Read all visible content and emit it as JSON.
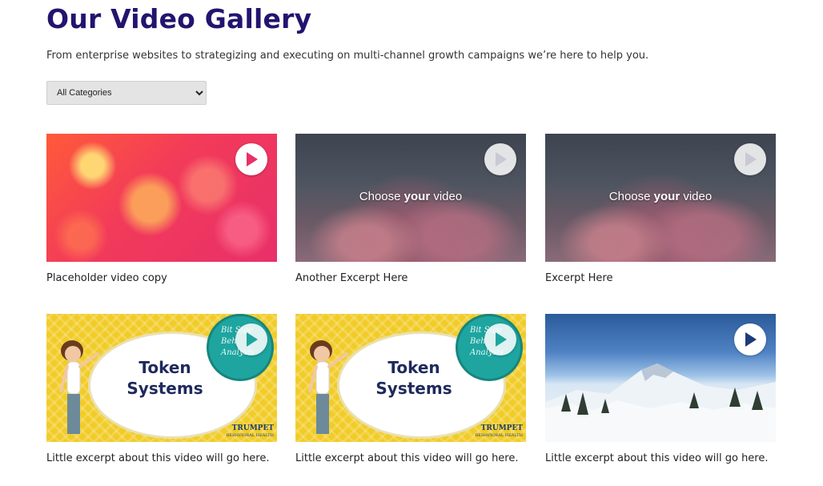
{
  "header": {
    "title": "Our Video Gallery",
    "subtitle": "From enterprise websites to strategizing and executing on multi-channel growth campaigns we’re here to help you."
  },
  "filter": {
    "selected": "All Categories",
    "options": [
      "All Categories"
    ]
  },
  "videos": [
    {
      "caption": "Placeholder video copy",
      "thumbnail": "bokeh"
    },
    {
      "caption": "Another Excerpt Here",
      "thumbnail": "clouds",
      "overlay_pre": "Choose ",
      "overlay_bold": "your",
      "overlay_post": " video"
    },
    {
      "caption": "Excerpt Here",
      "thumbnail": "clouds",
      "overlay_pre": "Choose ",
      "overlay_bold": "your",
      "overlay_post": " video"
    },
    {
      "caption": "Little excerpt about this video will go here.",
      "thumbnail": "token",
      "title_line1": "Token",
      "title_line2": "Systems",
      "badge_line1": "Bit",
      "badge_line2": "Sige",
      "badge_line3": "Beh",
      "badge_line4": "Analysis",
      "logo": "TRUMPET",
      "logo_sub": "BEHAVIORAL HEALTH"
    },
    {
      "caption": "Little excerpt about this video will go here.",
      "thumbnail": "token",
      "title_line1": "Token",
      "title_line2": "Systems",
      "badge_line1": "Bit",
      "badge_line2": "Sige",
      "badge_line3": "Beh",
      "badge_line4": "Analysis",
      "logo": "TRUMPET",
      "logo_sub": "BEHAVIORAL HEALTH"
    },
    {
      "caption": "Little excerpt about this video will go here.",
      "thumbnail": "mountain"
    }
  ],
  "icons": {
    "play": "play-icon",
    "dropdown": "chevron-down-icon"
  },
  "colors": {
    "title": "#23146f",
    "play_arrow": "#1d3a7a"
  }
}
